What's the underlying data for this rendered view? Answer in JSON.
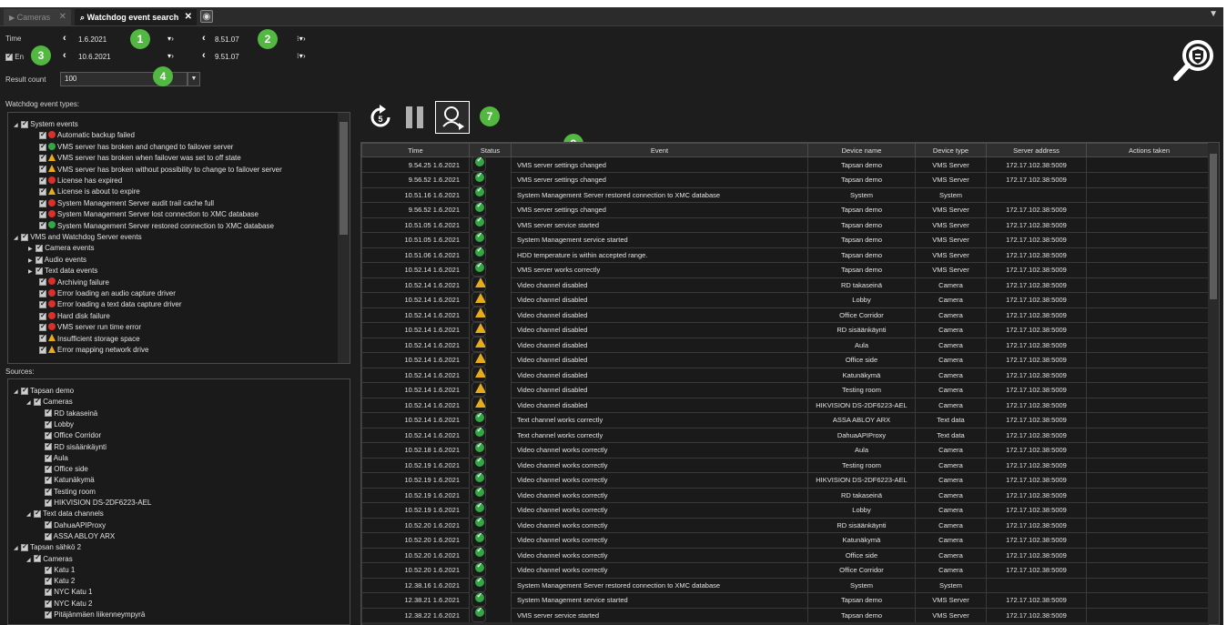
{
  "tabs": [
    {
      "label": "Cameras",
      "close": "✕"
    },
    {
      "label": "Watchdog event search",
      "close": "✕"
    }
  ],
  "time_filter": {
    "time_label": "Time",
    "end_label": "En",
    "start_date": "1.6.2021",
    "start_time": "8.51.07",
    "end_date": "10.6.2021",
    "end_time": "9.51.07",
    "result_count_label": "Result count",
    "result_count": "100"
  },
  "badges": [
    "1",
    "2",
    "3",
    "4",
    "5",
    "6",
    "7",
    "8",
    "9"
  ],
  "event_types": {
    "title": "Watchdog event types:",
    "groups": [
      {
        "label": "System events",
        "items": [
          {
            "label": "Automatic backup failed",
            "status": "err"
          },
          {
            "label": "VMS server has broken and changed to failover server",
            "status": "ok"
          },
          {
            "label": "VMS server has broken when failover was set to off state",
            "status": "warn"
          },
          {
            "label": "VMS server has broken without possibility to change to failover server",
            "status": "warn"
          },
          {
            "label": "License has expired",
            "status": "err"
          },
          {
            "label": "License is about to expire",
            "status": "warn"
          },
          {
            "label": "System Management Server audit trail cache full",
            "status": "err"
          },
          {
            "label": "System Management Server lost connection to XMC database",
            "status": "err"
          },
          {
            "label": "System Management Server restored connection to XMC database",
            "status": "ok"
          }
        ]
      },
      {
        "label": "VMS and Watchdog Server events",
        "items": [
          {
            "label": "Camera events",
            "status": "group"
          },
          {
            "label": "Audio events",
            "status": "group"
          },
          {
            "label": "Text data events",
            "status": "group"
          },
          {
            "label": "Archiving failure",
            "status": "err"
          },
          {
            "label": "Error loading an audio capture driver",
            "status": "err"
          },
          {
            "label": "Error loading a text data capture driver",
            "status": "err"
          },
          {
            "label": "Hard disk failure",
            "status": "err"
          },
          {
            "label": "VMS server run time error",
            "status": "err"
          },
          {
            "label": "Insufficient storage space",
            "status": "warn"
          },
          {
            "label": "Error mapping network drive",
            "status": "warn"
          }
        ]
      }
    ]
  },
  "sources": {
    "title": "Sources:",
    "tree": [
      {
        "level": 0,
        "label": "Tapsan demo"
      },
      {
        "level": 1,
        "label": "Cameras"
      },
      {
        "level": 2,
        "label": "RD takaseinä"
      },
      {
        "level": 2,
        "label": "Lobby"
      },
      {
        "level": 2,
        "label": "Office Corridor"
      },
      {
        "level": 2,
        "label": "RD sisäänkäynti"
      },
      {
        "level": 2,
        "label": "Aula"
      },
      {
        "level": 2,
        "label": "Office side"
      },
      {
        "level": 2,
        "label": "Katunäkymä"
      },
      {
        "level": 2,
        "label": "Testing room"
      },
      {
        "level": 2,
        "label": "HIKVISION DS-2DF6223-AEL"
      },
      {
        "level": 1,
        "label": "Text data channels"
      },
      {
        "level": 2,
        "label": "DahuaAPIProxy"
      },
      {
        "level": 2,
        "label": "ASSA ABLOY ARX"
      },
      {
        "level": 0,
        "label": "Tapsan sähkö 2"
      },
      {
        "level": 1,
        "label": "Cameras"
      },
      {
        "level": 2,
        "label": "Katu 1"
      },
      {
        "level": 2,
        "label": "Katu 2"
      },
      {
        "level": 2,
        "label": "NYC Katu 1"
      },
      {
        "level": 2,
        "label": "NYC Katu 2"
      },
      {
        "level": 2,
        "label": "Pitäjänmäen liikenneympyrä"
      }
    ]
  },
  "results": {
    "columns": [
      "Time",
      "Status",
      "Event",
      "Device name",
      "Device type",
      "Server address",
      "Actions taken"
    ],
    "rows": [
      [
        "9.54.25  1.6.2021",
        "ok",
        "VMS server settings changed",
        "Tapsan demo",
        "VMS Server",
        "172.17.102.38:5009"
      ],
      [
        "9.56.52  1.6.2021",
        "ok",
        "VMS server settings changed",
        "Tapsan demo",
        "VMS Server",
        "172.17.102.38:5009"
      ],
      [
        "10.51.16  1.6.2021",
        "ok",
        "System Management Server restored connection to XMC database",
        "System",
        "System",
        ""
      ],
      [
        "9.56.52  1.6.2021",
        "ok",
        "VMS server settings changed",
        "Tapsan demo",
        "VMS Server",
        "172.17.102.38:5009"
      ],
      [
        "10.51.05  1.6.2021",
        "ok",
        "VMS server service started",
        "Tapsan demo",
        "VMS Server",
        "172.17.102.38:5009"
      ],
      [
        "10.51.05  1.6.2021",
        "ok",
        "System Management service started",
        "Tapsan demo",
        "VMS Server",
        "172.17.102.38:5009"
      ],
      [
        "10.51.06  1.6.2021",
        "ok",
        "HDD temperature is within accepted range.",
        "Tapsan demo",
        "VMS Server",
        "172.17.102.38:5009"
      ],
      [
        "10.52.14  1.6.2021",
        "ok",
        "VMS server works correctly",
        "Tapsan demo",
        "VMS Server",
        "172.17.102.38:5009"
      ],
      [
        "10.52.14  1.6.2021",
        "warn",
        "Video channel disabled",
        "RD takaseinä",
        "Camera",
        "172.17.102.38:5009"
      ],
      [
        "10.52.14  1.6.2021",
        "warn",
        "Video channel disabled",
        "Lobby",
        "Camera",
        "172.17.102.38:5009"
      ],
      [
        "10.52.14  1.6.2021",
        "warn",
        "Video channel disabled",
        "Office Corridor",
        "Camera",
        "172.17.102.38:5009"
      ],
      [
        "10.52.14  1.6.2021",
        "warn",
        "Video channel disabled",
        "RD sisäänkäynti",
        "Camera",
        "172.17.102.38:5009"
      ],
      [
        "10.52.14  1.6.2021",
        "warn",
        "Video channel disabled",
        "Aula",
        "Camera",
        "172.17.102.38:5009"
      ],
      [
        "10.52.14  1.6.2021",
        "warn",
        "Video channel disabled",
        "Office side",
        "Camera",
        "172.17.102.38:5009"
      ],
      [
        "10.52.14  1.6.2021",
        "warn",
        "Video channel disabled",
        "Katunäkymä",
        "Camera",
        "172.17.102.38:5009"
      ],
      [
        "10.52.14  1.6.2021",
        "warn",
        "Video channel disabled",
        "Testing room",
        "Camera",
        "172.17.102.38:5009"
      ],
      [
        "10.52.14  1.6.2021",
        "warn",
        "Video channel disabled",
        "HIKVISION DS-2DF6223-AEL",
        "Camera",
        "172.17.102.38:5009"
      ],
      [
        "10.52.14  1.6.2021",
        "ok",
        "Text channel works correctly",
        "ASSA ABLOY ARX",
        "Text data",
        "172.17.102.38:5009"
      ],
      [
        "10.52.14  1.6.2021",
        "ok",
        "Text channel works correctly",
        "DahuaAPIProxy",
        "Text data",
        "172.17.102.38:5009"
      ],
      [
        "10.52.18  1.6.2021",
        "ok",
        "Video channel works correctly",
        "Aula",
        "Camera",
        "172.17.102.38:5009"
      ],
      [
        "10.52.19  1.6.2021",
        "ok",
        "Video channel works correctly",
        "Testing room",
        "Camera",
        "172.17.102.38:5009"
      ],
      [
        "10.52.19  1.6.2021",
        "ok",
        "Video channel works correctly",
        "HIKVISION DS-2DF6223-AEL",
        "Camera",
        "172.17.102.38:5009"
      ],
      [
        "10.52.19  1.6.2021",
        "ok",
        "Video channel works correctly",
        "RD takaseinä",
        "Camera",
        "172.17.102.38:5009"
      ],
      [
        "10.52.19  1.6.2021",
        "ok",
        "Video channel works correctly",
        "Lobby",
        "Camera",
        "172.17.102.38:5009"
      ],
      [
        "10.52.20  1.6.2021",
        "ok",
        "Video channel works correctly",
        "RD sisäänkäynti",
        "Camera",
        "172.17.102.38:5009"
      ],
      [
        "10.52.20  1.6.2021",
        "ok",
        "Video channel works correctly",
        "Katunäkymä",
        "Camera",
        "172.17.102.38:5009"
      ],
      [
        "10.52.20  1.6.2021",
        "ok",
        "Video channel works correctly",
        "Office side",
        "Camera",
        "172.17.102.38:5009"
      ],
      [
        "10.52.20  1.6.2021",
        "ok",
        "Video channel works correctly",
        "Office Corridor",
        "Camera",
        "172.17.102.38:5009"
      ],
      [
        "12.38.16  1.6.2021",
        "ok",
        "System Management Server restored connection to XMC database",
        "System",
        "System",
        ""
      ],
      [
        "12.38.21  1.6.2021",
        "ok",
        "System Management service started",
        "Tapsan demo",
        "VMS Server",
        "172.17.102.38:5009"
      ],
      [
        "12.38.22  1.6.2021",
        "ok",
        "VMS server service started",
        "Tapsan demo",
        "VMS Server",
        "172.17.102.38:5009"
      ],
      [
        "12.38.23  1.6.2021",
        "ok",
        "HDD temperature is within accepted range.",
        "Tapsan demo",
        "VMS Server",
        "172.17.102.38:5009"
      ],
      [
        "12.38.30  1.6.2021",
        "ok",
        "VMS server works correctly",
        "Tapsan demo",
        "VMS Server",
        "172.17.102.38:5009"
      ]
    ]
  },
  "colors": {
    "accent_green": "#52b841",
    "ok": "#35a645",
    "warn": "#e6ac1c",
    "err": "#d9302a"
  },
  "icons": {
    "time_icon": "camera-icon",
    "tab_icon": "binoculars-icon",
    "search": "magnifier-shield-icon"
  }
}
